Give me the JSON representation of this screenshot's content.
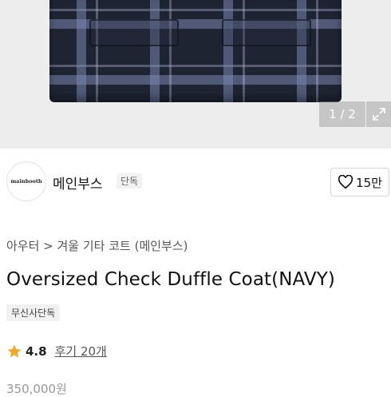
{
  "gallery": {
    "counter": "1 / 2"
  },
  "brand": {
    "logo_text": "mainbooth",
    "name": "메인부스",
    "exclusive_tag": "단독"
  },
  "like": {
    "count": "15만"
  },
  "breadcrumb": "아우터 > 겨울 기타 코트 (메인부스)",
  "product": {
    "title": "Oversized Check Duffle Coat(NAVY)",
    "badge": "무신사단독",
    "rating": "4.8",
    "reviews": "후기 20개",
    "price": "350,000원"
  },
  "colors": {
    "star": "#f5a623",
    "coat": "#1f2433"
  }
}
